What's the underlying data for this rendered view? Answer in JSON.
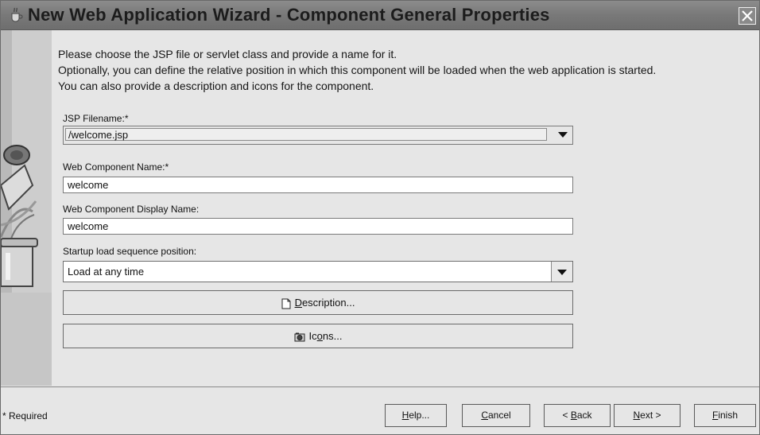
{
  "window": {
    "title": "New Web Application Wizard - Component General Properties"
  },
  "intro": {
    "line1": "Please choose the JSP file or servlet class and provide a name for it.",
    "line2": "Optionally, you can define the relative position in which this component will be loaded when the web application is started.",
    "line3": "You can also provide a description and icons for the component."
  },
  "form": {
    "jsp_label": "JSP Filename:*",
    "jsp_value": "/welcome.jsp",
    "component_name_label": "Web Component Name:*",
    "component_name_value": "welcome",
    "display_name_label": "Web Component Display Name:",
    "display_name_value": "welcome",
    "startup_label": "Startup load sequence position:",
    "startup_value": "Load at any time",
    "description_button": {
      "pre": "",
      "mnemonic": "D",
      "post": "escription..."
    },
    "icons_button": {
      "pre": "Ic",
      "mnemonic": "o",
      "post": "ns..."
    }
  },
  "footer": {
    "required_note": "* Required",
    "help": {
      "pre": "",
      "mnemonic": "H",
      "post": "elp..."
    },
    "cancel": {
      "pre": "",
      "mnemonic": "C",
      "post": "ancel"
    },
    "back": {
      "pre": "< ",
      "mnemonic": "B",
      "post": "ack"
    },
    "next": {
      "pre": "",
      "mnemonic": "N",
      "post": "ext >"
    },
    "finish": {
      "pre": "",
      "mnemonic": "F",
      "post": "inish"
    }
  },
  "icons": {
    "title": "java-cup-icon",
    "close": "close-icon",
    "description": "document-icon",
    "icons_button": "camera-icon",
    "dropdown": "chevron-down-icon"
  }
}
